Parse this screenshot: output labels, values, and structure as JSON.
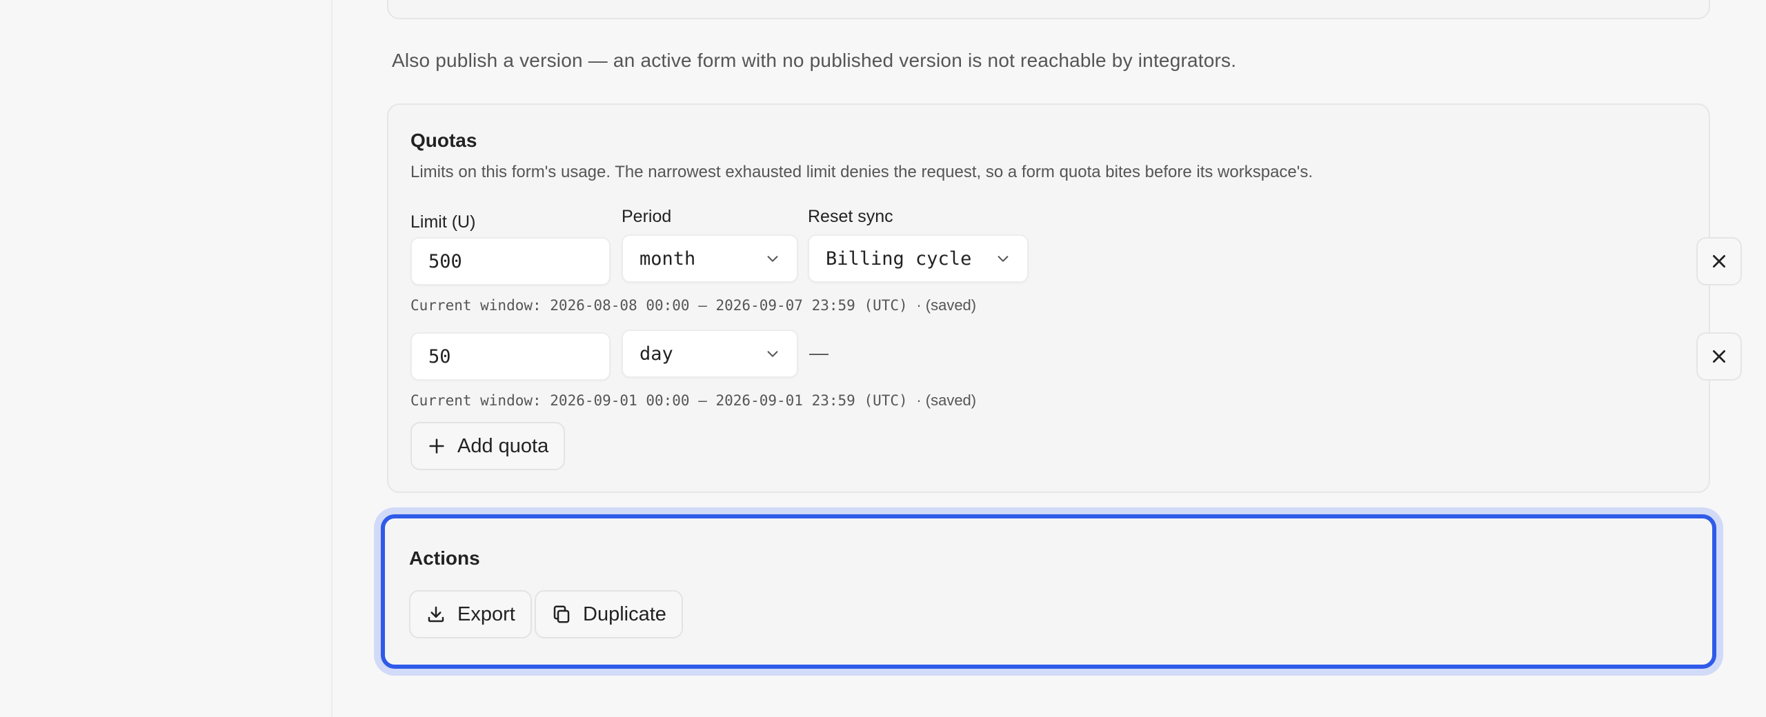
{
  "note": "Also publish a version — an active form with no published version is not reachable by integrators.",
  "quotas": {
    "title": "Quotas",
    "description": "Limits on this form's usage. The narrowest exhausted limit denies the request, so a form quota bites before its workspace's.",
    "labels": {
      "limit": "Limit (U)",
      "period": "Period",
      "reset_sync": "Reset sync"
    },
    "rows": [
      {
        "limit": "500",
        "period": "month",
        "reset_sync": "Billing cycle",
        "window": "Current window: 2026-08-08 00:00 – 2026-09-07 23:59 (UTC)",
        "status": "· (saved)"
      },
      {
        "limit": "50",
        "period": "day",
        "reset_sync": "—",
        "window": "Current window: 2026-09-01 00:00 – 2026-09-01 23:59 (UTC)",
        "status": "· (saved)"
      }
    ],
    "add_label": "Add quota"
  },
  "actions": {
    "title": "Actions",
    "export_label": "Export",
    "duplicate_label": "Duplicate"
  },
  "colors": {
    "focus_ring": "#2f5be8",
    "focus_halo": "#d1daf7",
    "background": "#f7f7f7"
  },
  "icons": {
    "select_chevron": "chevron-down-icon",
    "remove": "close-icon",
    "add": "plus-icon",
    "export": "download-icon",
    "duplicate": "copy-icon"
  }
}
